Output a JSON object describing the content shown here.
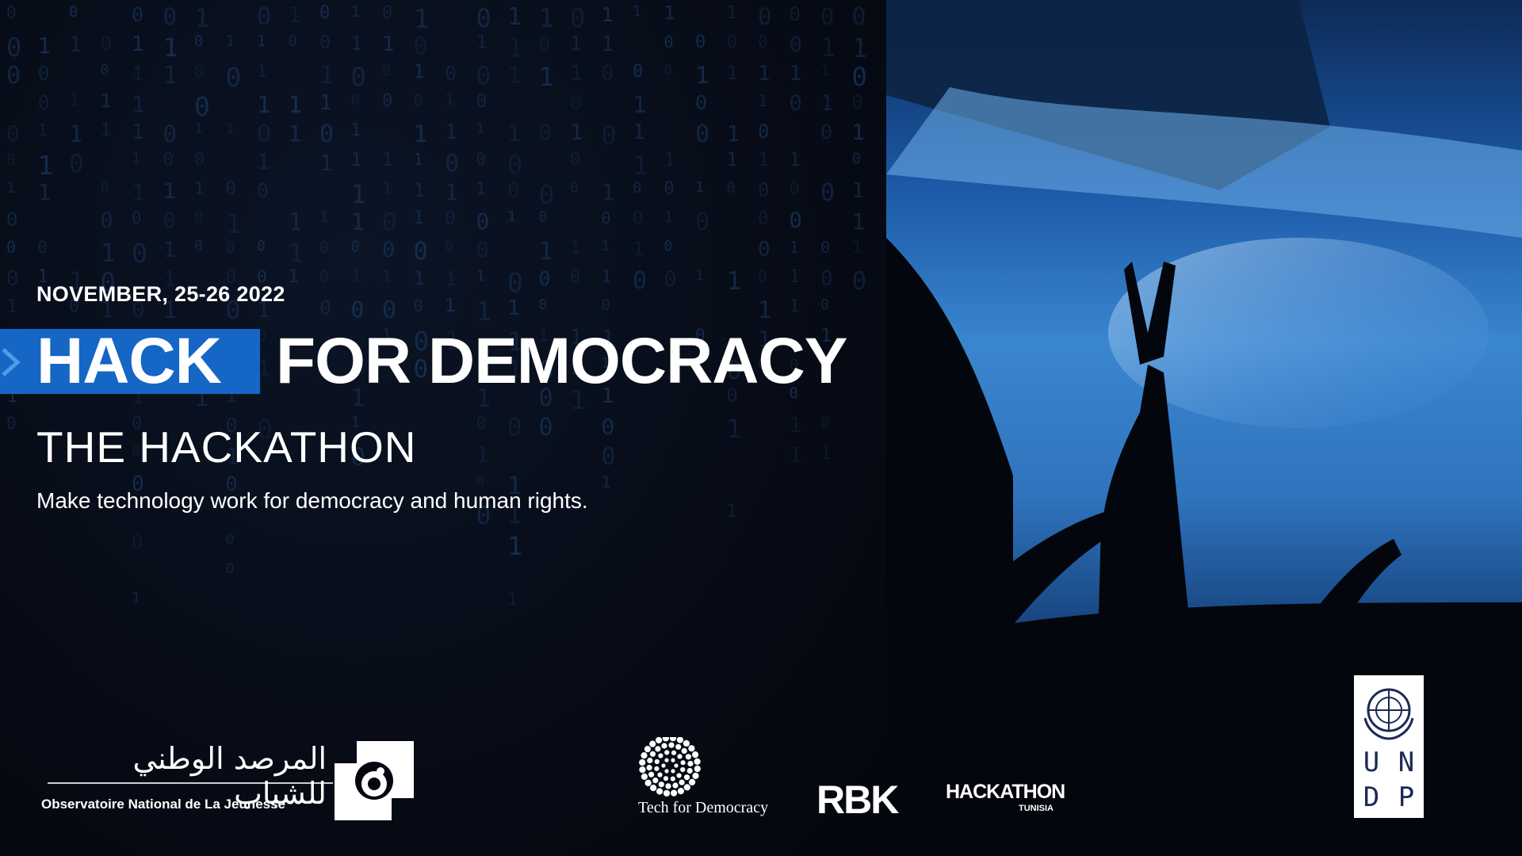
{
  "event": {
    "date": "NOVEMBER, 25-26  2022",
    "title_highlight": "HACK",
    "title_rest": "FOR DEMOCRACY",
    "subtitle": "THE HACKATHON",
    "tagline": "Make technology work for democracy and human rights."
  },
  "logos": {
    "onj_arabic": "المرصد الوطني للشباب",
    "onj_french": "Observatoire National de La Jeunesse",
    "t4d": "Tech for Democracy",
    "rbk": "RBK",
    "hackathon_main": "HACKATHON",
    "hackathon_sub": "TUNISIA",
    "undp_letters": [
      "U",
      "N",
      "D",
      "P"
    ]
  },
  "colors": {
    "background": "#050812",
    "accent_blue": "#1566c5",
    "text": "#ffffff",
    "matrix": "#1b3a66"
  },
  "background_photo": "raised hands silhouetted under a blue flag"
}
